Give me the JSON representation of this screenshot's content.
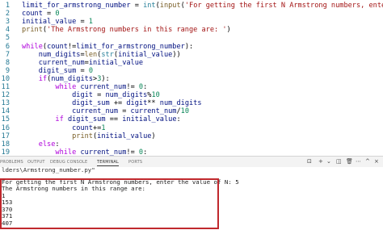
{
  "editor": {
    "lines": [
      {
        "ln": "1",
        "html_parts": [
          [
            "v",
            "limit_for_armstrong_number"
          ],
          [
            "o",
            " = "
          ],
          [
            "b",
            "int"
          ],
          [
            "o",
            "("
          ],
          [
            "f",
            "input"
          ],
          [
            "o",
            "("
          ],
          [
            "s",
            "'For getting the first N Armstrong numbers, enter the value of N: '"
          ],
          [
            "o",
            "))"
          ]
        ]
      },
      {
        "ln": "2",
        "html_parts": [
          [
            "v",
            "count"
          ],
          [
            "o",
            " = "
          ],
          [
            "n",
            "0"
          ]
        ]
      },
      {
        "ln": "3",
        "html_parts": [
          [
            "v",
            "initial_value"
          ],
          [
            "o",
            " = "
          ],
          [
            "n",
            "1"
          ]
        ]
      },
      {
        "ln": "4",
        "html_parts": [
          [
            "f",
            "print"
          ],
          [
            "o",
            "("
          ],
          [
            "s",
            "'The Armstrong numbers in this range are: '"
          ],
          [
            "o",
            ")"
          ]
        ]
      },
      {
        "ln": "5",
        "html_parts": []
      },
      {
        "ln": "6",
        "html_parts": [
          [
            "k",
            "while"
          ],
          [
            "o",
            "("
          ],
          [
            "v",
            "count"
          ],
          [
            "o",
            "!="
          ],
          [
            "v",
            "limit_for_armstrong_number"
          ],
          [
            "o",
            "):"
          ]
        ]
      },
      {
        "ln": "7",
        "html_parts": [
          [
            "o",
            "    "
          ],
          [
            "v",
            "num_digits"
          ],
          [
            "o",
            "="
          ],
          [
            "f",
            "len"
          ],
          [
            "o",
            "("
          ],
          [
            "b",
            "str"
          ],
          [
            "o",
            "("
          ],
          [
            "v",
            "initial_value"
          ],
          [
            "o",
            "))"
          ]
        ]
      },
      {
        "ln": "8",
        "html_parts": [
          [
            "o",
            "    "
          ],
          [
            "v",
            "current_num"
          ],
          [
            "o",
            "="
          ],
          [
            "v",
            "initial_value"
          ]
        ]
      },
      {
        "ln": "9",
        "html_parts": [
          [
            "o",
            "    "
          ],
          [
            "v",
            "digit_sum"
          ],
          [
            "o",
            " = "
          ],
          [
            "n",
            "0"
          ]
        ]
      },
      {
        "ln": "10",
        "html_parts": [
          [
            "o",
            "    "
          ],
          [
            "k",
            "if"
          ],
          [
            "o",
            "("
          ],
          [
            "v",
            "num_digits"
          ],
          [
            "o",
            ">"
          ],
          [
            "n",
            "3"
          ],
          [
            "o",
            "):"
          ]
        ]
      },
      {
        "ln": "11",
        "html_parts": [
          [
            "o",
            "        "
          ],
          [
            "k",
            "while"
          ],
          [
            "o",
            " "
          ],
          [
            "v",
            "current_num"
          ],
          [
            "o",
            "!= "
          ],
          [
            "n",
            "0"
          ],
          [
            "o",
            ":"
          ]
        ]
      },
      {
        "ln": "12",
        "html_parts": [
          [
            "o",
            "            "
          ],
          [
            "v",
            "digit"
          ],
          [
            "o",
            " = "
          ],
          [
            "v",
            "num_digits"
          ],
          [
            "o",
            "%"
          ],
          [
            "n",
            "10"
          ]
        ]
      },
      {
        "ln": "13",
        "html_parts": [
          [
            "o",
            "            "
          ],
          [
            "v",
            "digit_sum"
          ],
          [
            "o",
            " += "
          ],
          [
            "v",
            "digit"
          ],
          [
            "o",
            "** "
          ],
          [
            "v",
            "num_digits"
          ]
        ]
      },
      {
        "ln": "14",
        "html_parts": [
          [
            "o",
            "            "
          ],
          [
            "v",
            "current_num"
          ],
          [
            "o",
            " = "
          ],
          [
            "v",
            "current_num"
          ],
          [
            "o",
            "/"
          ],
          [
            "n",
            "10"
          ]
        ]
      },
      {
        "ln": "15",
        "html_parts": [
          [
            "o",
            "        "
          ],
          [
            "k",
            "if"
          ],
          [
            "o",
            " "
          ],
          [
            "v",
            "digit_sum"
          ],
          [
            "o",
            " == "
          ],
          [
            "v",
            "initial_value"
          ],
          [
            "o",
            ":"
          ]
        ]
      },
      {
        "ln": "16",
        "html_parts": [
          [
            "o",
            "            "
          ],
          [
            "v",
            "count"
          ],
          [
            "o",
            "+="
          ],
          [
            "n",
            "1"
          ]
        ]
      },
      {
        "ln": "17",
        "html_parts": [
          [
            "o",
            "            "
          ],
          [
            "f",
            "print"
          ],
          [
            "o",
            "("
          ],
          [
            "v",
            "initial_value"
          ],
          [
            "o",
            ")"
          ]
        ]
      },
      {
        "ln": "18",
        "html_parts": [
          [
            "o",
            "    "
          ],
          [
            "k",
            "else"
          ],
          [
            "o",
            ":"
          ]
        ]
      },
      {
        "ln": "19",
        "html_parts": [
          [
            "o",
            "        "
          ],
          [
            "k",
            "while"
          ],
          [
            "o",
            " "
          ],
          [
            "v",
            "current_num"
          ],
          [
            "o",
            "!= "
          ],
          [
            "n",
            "0"
          ],
          [
            "o",
            ":"
          ]
        ]
      }
    ]
  },
  "panel": {
    "tabs": [
      "PROBLEMS",
      "OUTPUT",
      "DEBUG CONSOLE",
      "TERMINAL",
      "PORTS"
    ],
    "active_tab": "TERMINAL"
  },
  "terminal": {
    "path_line": "lders\\Armstrong_number.py\"",
    "output": [
      "For getting the first N Armstrong numbers, enter the value of N: 5",
      "The Armstrong numbers in this range are:",
      "1",
      "153",
      "370",
      "371",
      "407"
    ]
  }
}
